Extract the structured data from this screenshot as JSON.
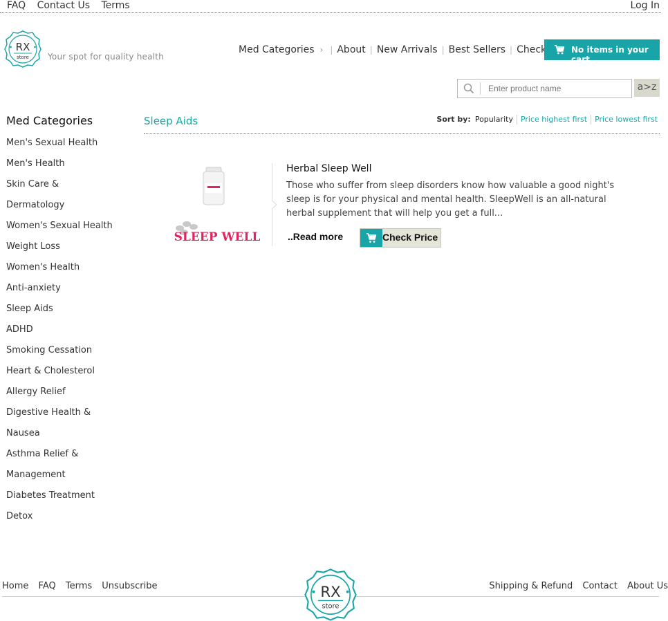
{
  "topbar": {
    "links": [
      "FAQ",
      "Contact Us",
      "Terms"
    ],
    "login": "Log In"
  },
  "header": {
    "logo_text": "RX",
    "logo_sub": "store",
    "tagline": "Your spot for quality health",
    "nav": [
      "Med Categories",
      "About",
      "New Arrivals",
      "Best Sellers",
      "Checkout"
    ],
    "cart_label": "No items in your cart"
  },
  "search": {
    "placeholder": "Enter product name",
    "az_label": "a>z"
  },
  "sidebar": {
    "title": "Med Categories",
    "items": [
      "Men's Sexual Health",
      "Men's Health",
      "Skin Care &",
      "Dermatology",
      "Women's Sexual Health",
      "Weight Loss",
      "Women's Health",
      "Anti-anxiety",
      "Sleep Aids",
      "ADHD",
      "Smoking Cessation",
      "Heart & Cholesterol",
      "Allergy Relief",
      "Digestive Health &",
      "Nausea",
      "Asthma Relief &",
      "Management",
      "Diabetes Treatment",
      "Detox"
    ]
  },
  "main": {
    "category_title": "Sleep Aids",
    "sort": {
      "label": "Sort by:",
      "options": [
        "Popularity",
        "Price highest first",
        "Price lowest first"
      ]
    },
    "product": {
      "image_brand": "SLEEP WELL",
      "title": "Herbal Sleep Well",
      "description": "Those who suffer from sleep disorders know how valuable a good night's sleep is for your physical and mental health. SleepWell is an all-natural herbal supplement that will help you get a full...",
      "read_more": "..Read more",
      "check_price": "Check Price"
    }
  },
  "footer": {
    "left_links": [
      "Home",
      "FAQ",
      "Terms",
      "Unsubscribe"
    ],
    "right_links": [
      "Shipping & Refund",
      "Contact",
      "About Us"
    ],
    "logo_text": "RX",
    "logo_sub": "store"
  },
  "colors": {
    "accent": "#19a5a8",
    "brand_pink": "#e0245e"
  },
  "icons": {
    "cart": "cart-icon",
    "search": "search-icon"
  }
}
